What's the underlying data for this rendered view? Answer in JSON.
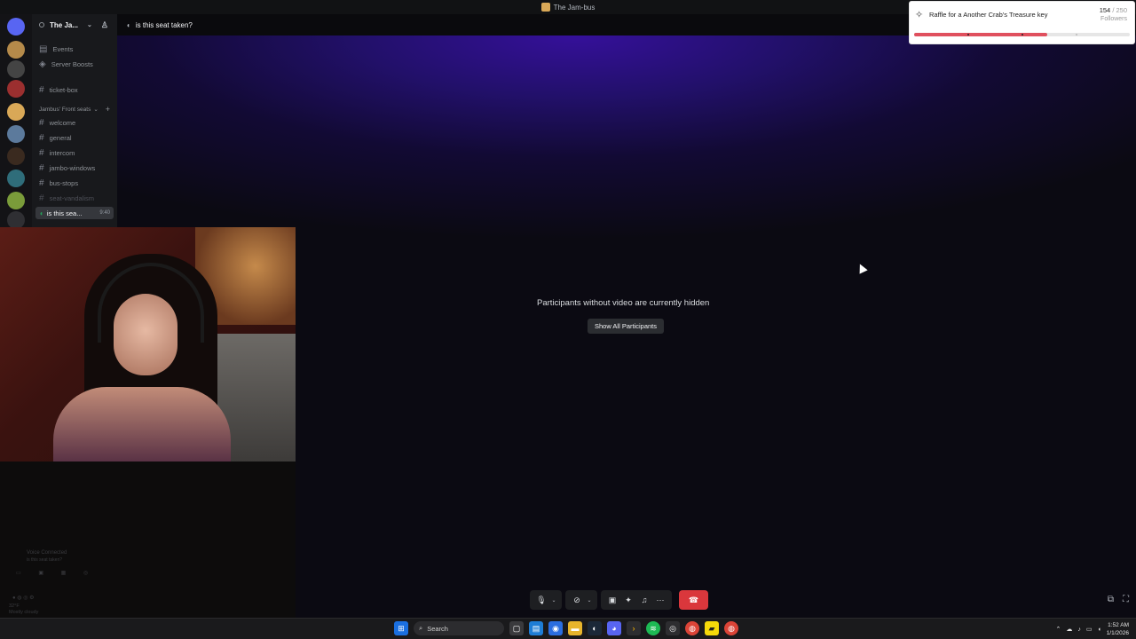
{
  "window": {
    "title": "The Jam-bus"
  },
  "server": {
    "name": "The Ja..."
  },
  "channels": {
    "events": "Events",
    "boosts": "Server Boosts",
    "ticket_box": "ticket-box",
    "category": "Jambus' Front seats",
    "items": [
      "welcome",
      "general",
      "intercom",
      "jambo-windows",
      "bus-stops",
      "seat-vandalism"
    ],
    "active_voice": "is this sea...",
    "active_time": "9:40"
  },
  "voice_header": {
    "channel": "is this seat taken?"
  },
  "stage": {
    "hidden_message": "Participants without video are currently hidden",
    "show_all_label": "Show All Participants"
  },
  "raffle": {
    "title": "Raffle for a Another Crab's Treasure key",
    "current": "154",
    "total": "/ 250",
    "unit": "Followers",
    "progress": 0.616
  },
  "lower_panel": {
    "voice_connected": "Voice Connected",
    "channel": "is this seat taken?",
    "weather_temp": "32°F",
    "weather_desc": "Mostly cloudy"
  },
  "controls": {
    "mic": "microphone-icon",
    "camera": "camera-off-icon",
    "share": "screen-share-icon",
    "activities": "activities-icon",
    "soundboard": "soundboard-icon",
    "more": "more-icon",
    "end": "end-call-icon"
  },
  "taskbar": {
    "search_placeholder": "Search",
    "time": "1:52 AM",
    "date": "1/1/2026"
  },
  "colors": {
    "end_call": "#da373c",
    "raffle_bar": "#e0505e",
    "voice_active": "#23a55a"
  }
}
